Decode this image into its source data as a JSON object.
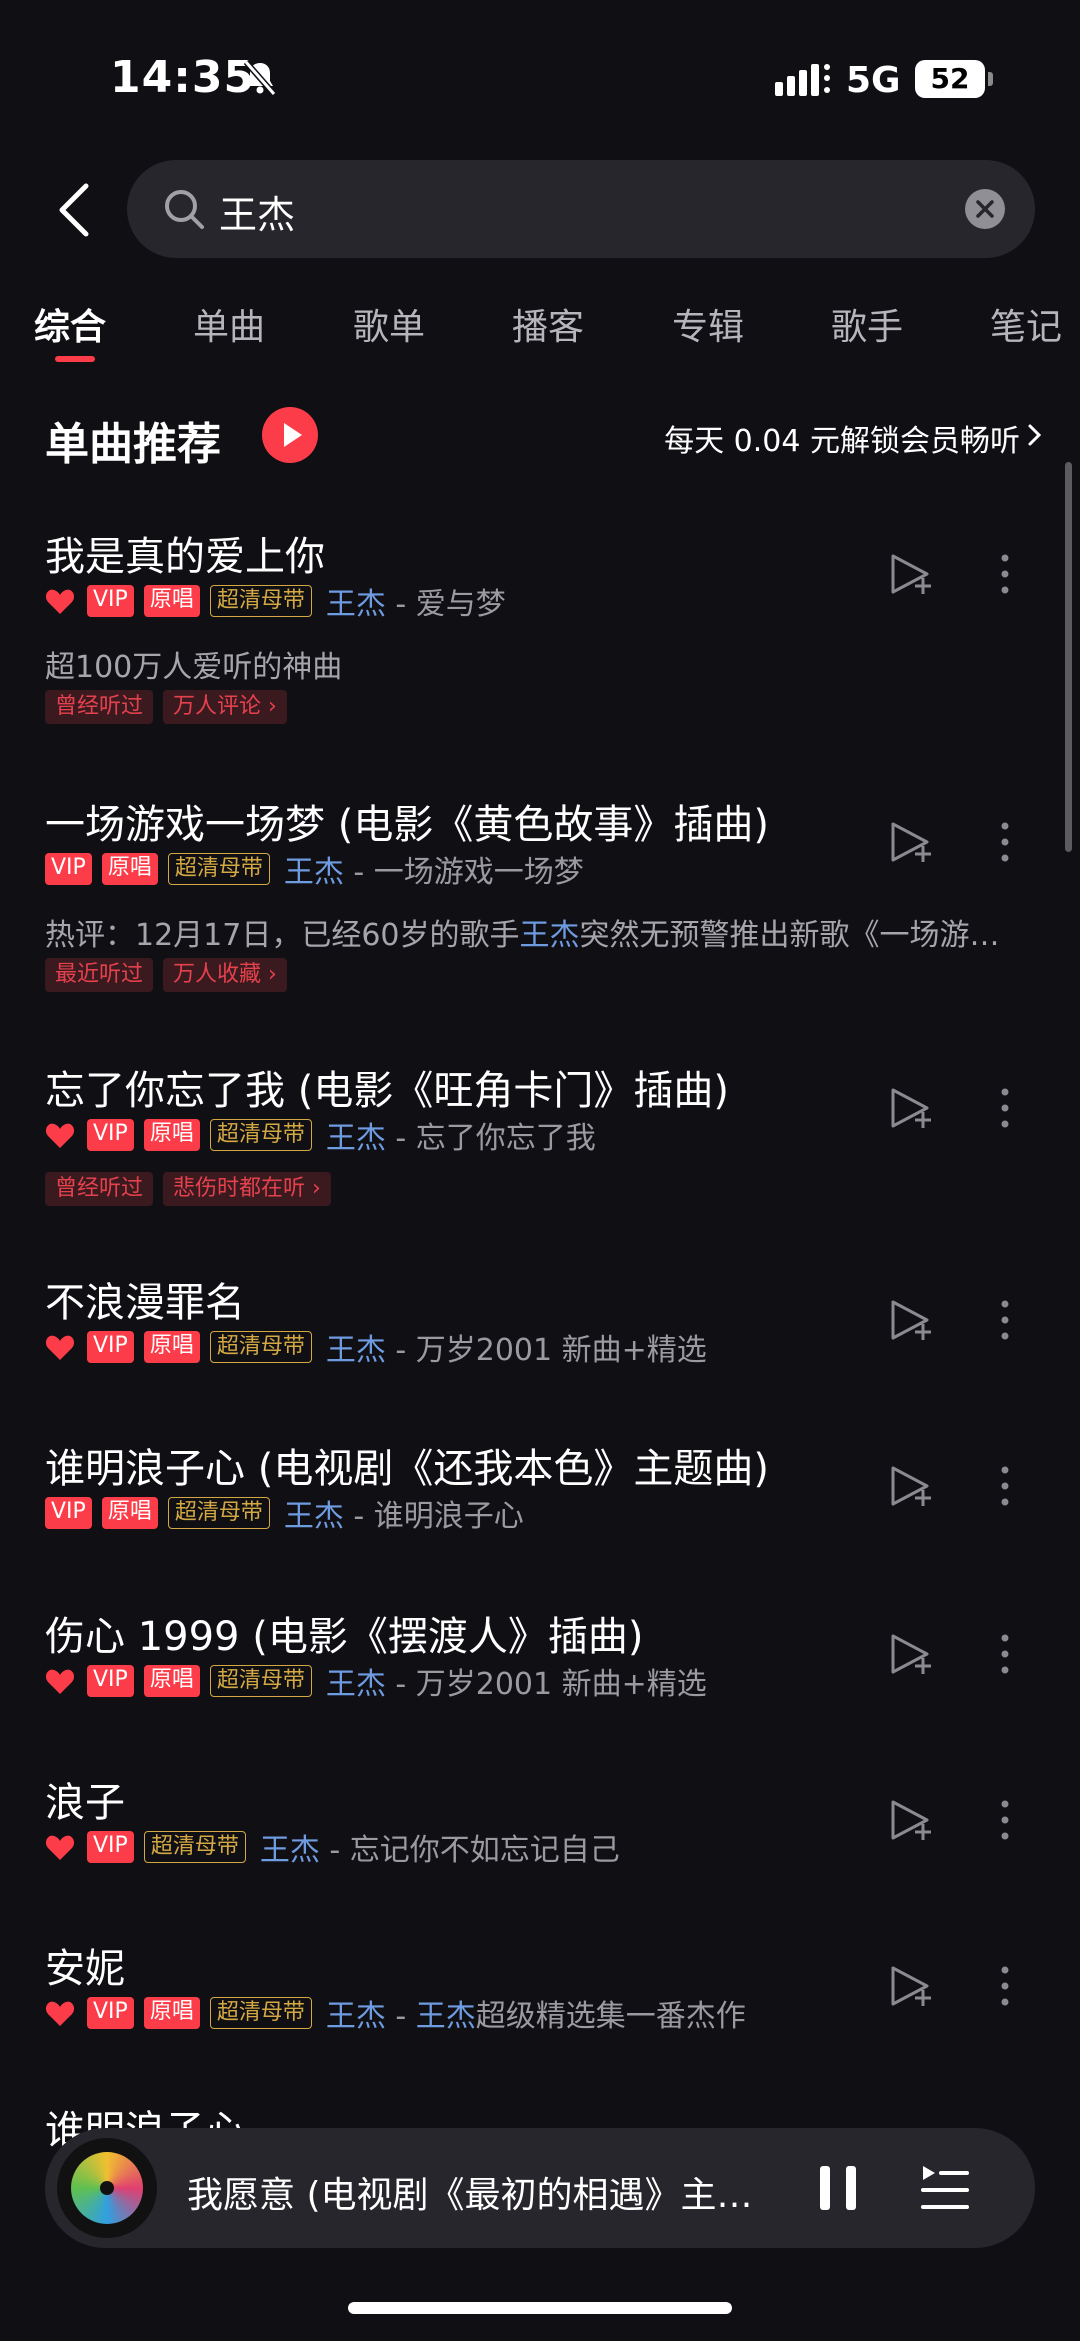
{
  "status_bar": {
    "time": "14:35",
    "network": "5G",
    "battery": "52"
  },
  "search": {
    "query": "王杰"
  },
  "tabs": [
    "综合",
    "单曲",
    "歌单",
    "播客",
    "专辑",
    "歌手",
    "笔记"
  ],
  "section": {
    "title": "单曲推荐",
    "promo": "每天 0.04 元解锁会员畅听"
  },
  "badges": {
    "vip": "VIP",
    "original": "原唱",
    "hq": "超清母带"
  },
  "songs": [
    {
      "title": "我是真的爱上你",
      "artist": "王杰",
      "album": "爱与梦",
      "desc": "超100万人爱听的神曲",
      "tags": [
        "曾经听过",
        "万人评论 ›"
      ]
    },
    {
      "title": "一场游戏一场梦 (电影《黄色故事》插曲)",
      "artist": "王杰",
      "album": "一场游戏一场梦",
      "desc_prefix": "热评：12月17日，已经60岁的歌手",
      "desc_hl": "王杰",
      "desc_suffix": "突然无预警推出新歌《一场游戏一场梦》",
      "tags": [
        "最近听过",
        "万人收藏 ›"
      ]
    },
    {
      "title": "忘了你忘了我 (电影《旺角卡门》插曲)",
      "artist": "王杰",
      "album": "忘了你忘了我",
      "tags": [
        "曾经听过",
        "悲伤时都在听 ›"
      ]
    },
    {
      "title": "不浪漫罪名",
      "artist": "王杰",
      "album": "万岁2001 新曲+精选"
    },
    {
      "title": "谁明浪子心 (电视剧《还我本色》主题曲)",
      "artist": "王杰",
      "album": "谁明浪子心"
    },
    {
      "title": "伤心 1999 (电影《摆渡人》插曲)",
      "artist": "王杰",
      "album": "万岁2001 新曲+精选"
    },
    {
      "title": "浪子",
      "artist": "王杰",
      "album": "忘记你不如忘记自己"
    },
    {
      "title": "安妮",
      "artist": "王杰",
      "album_hl": "王杰",
      "album": "超级精选集一番杰作"
    },
    {
      "title": "谁明浪子心"
    }
  ],
  "player": {
    "title": "我愿意 (电视剧《最初的相遇》主题曲)"
  },
  "colors": {
    "accent": "#fc3d49",
    "artist": "#6f9be0",
    "gold": "#d4a843"
  }
}
